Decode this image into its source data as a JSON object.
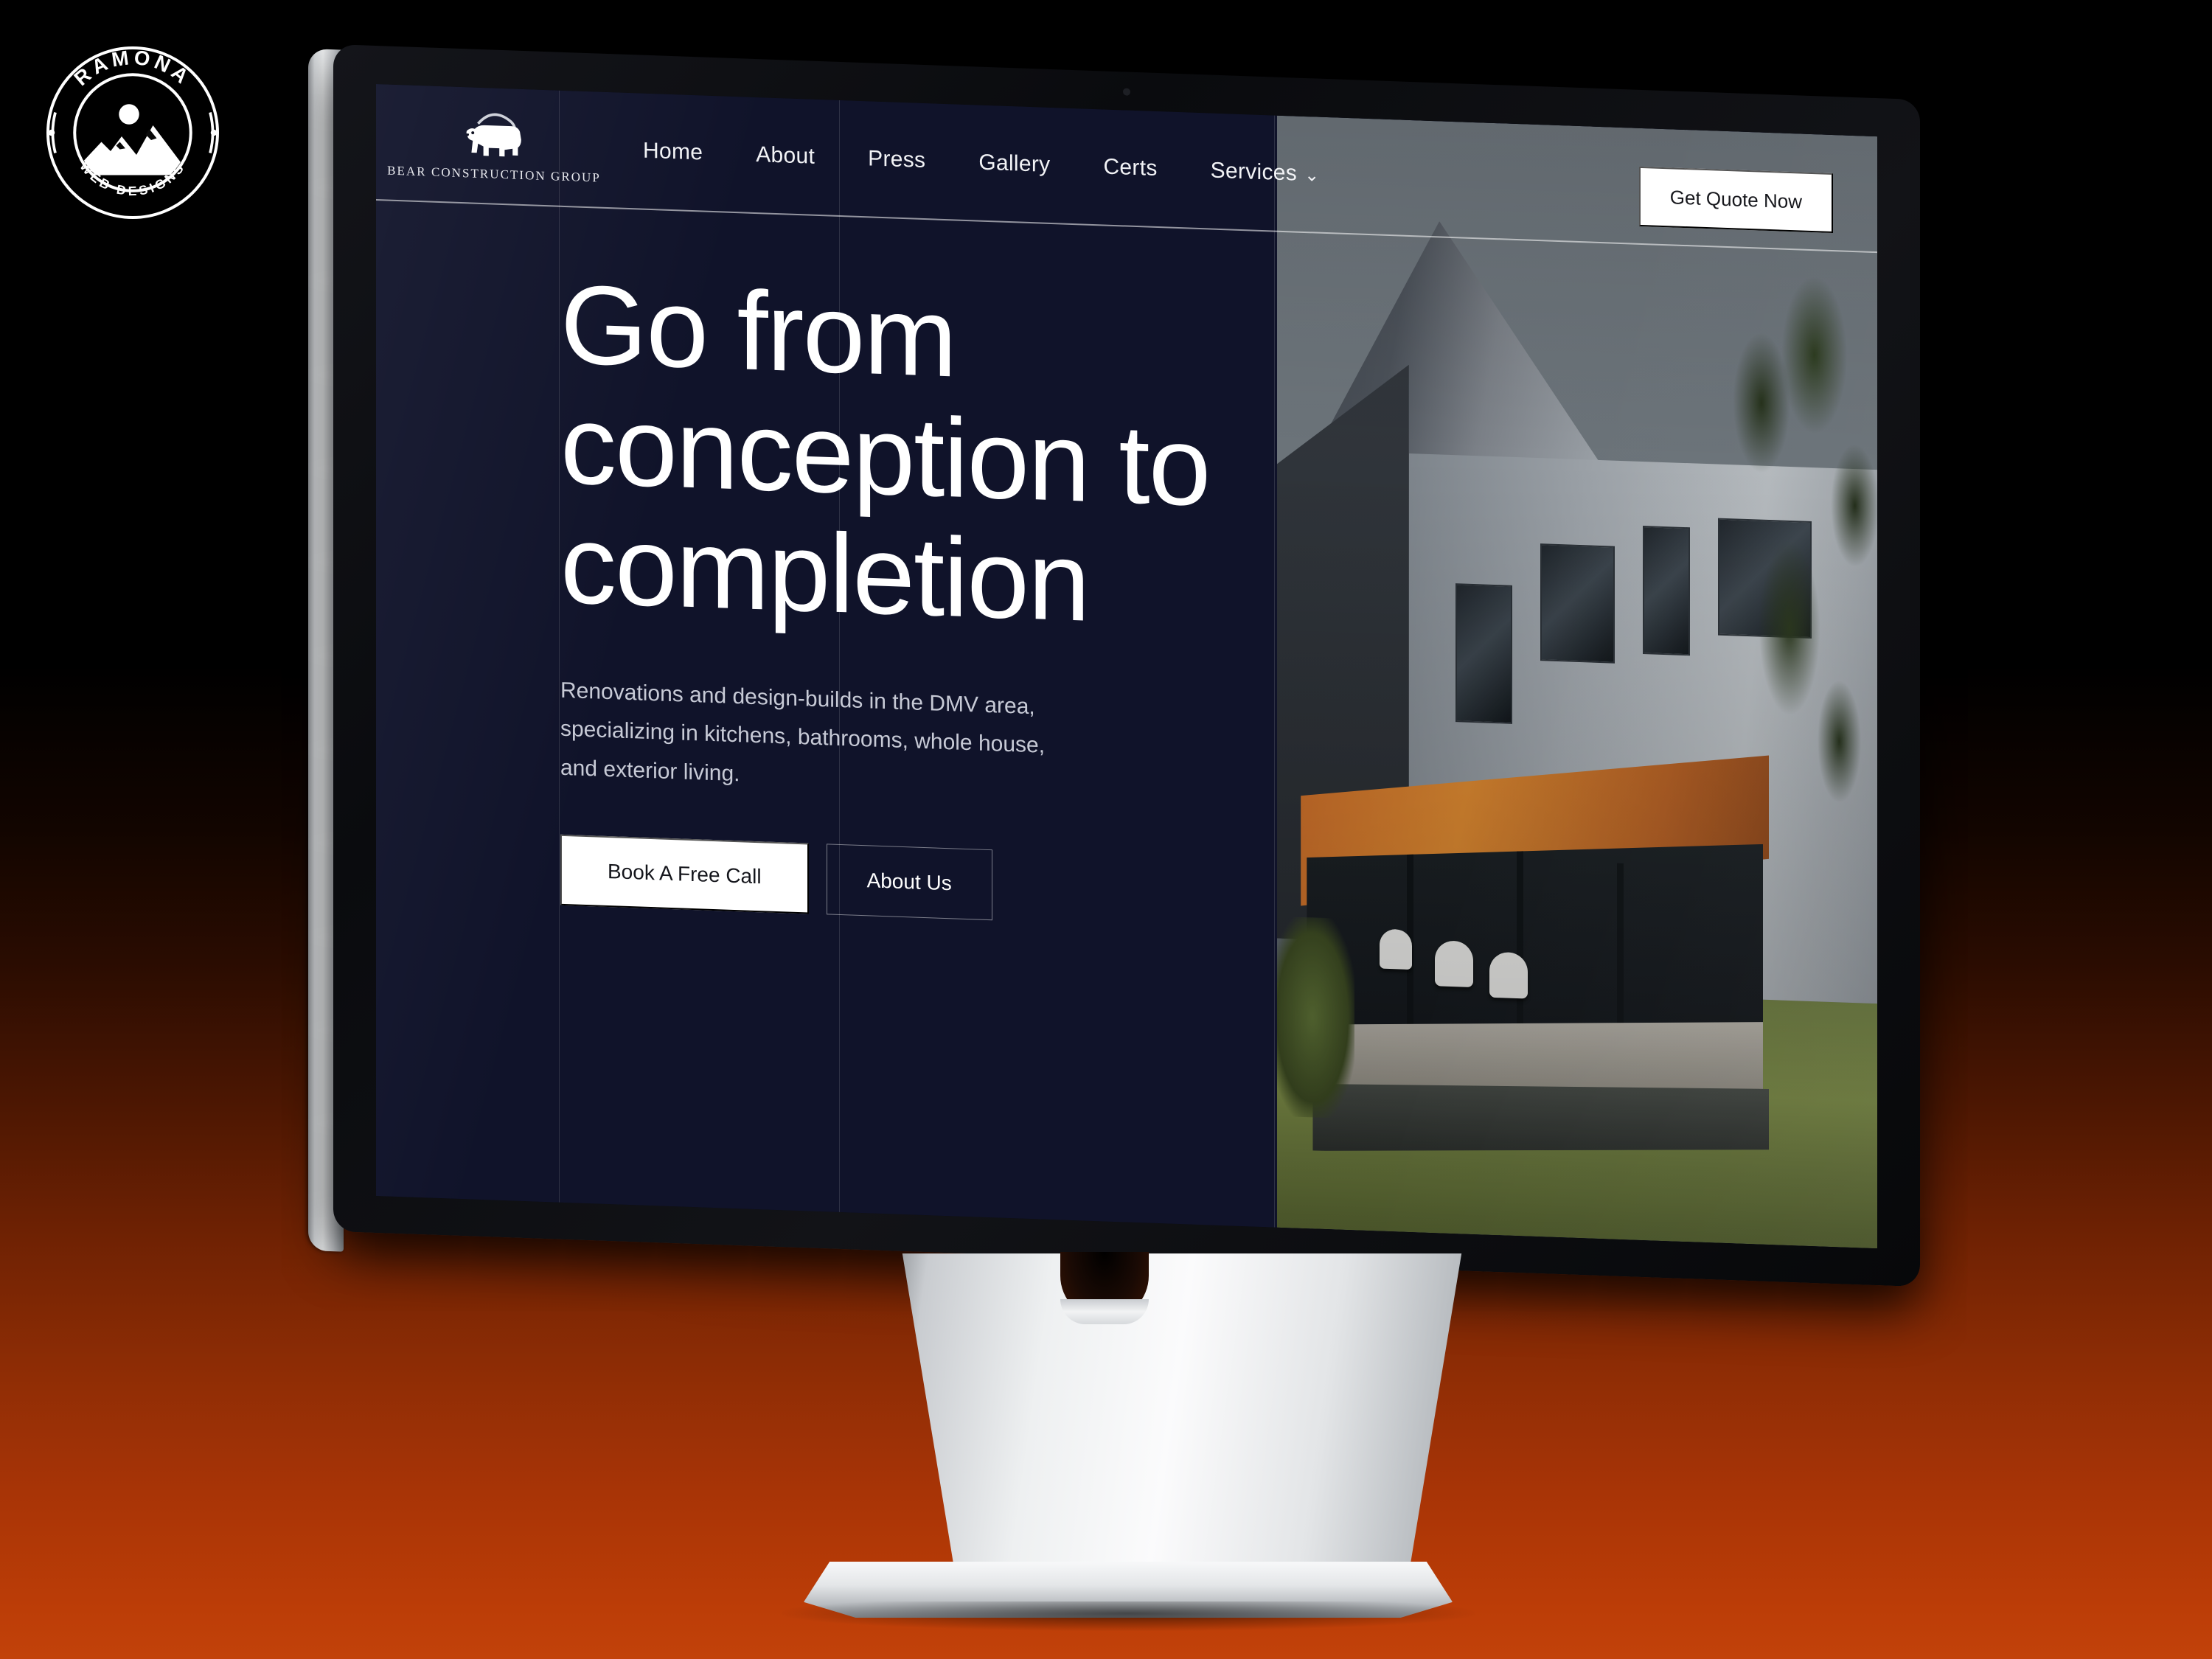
{
  "watermark": {
    "top_arc_text": "RAMONA",
    "bottom_arc_text": "WEB DESIGNS",
    "emblem": "mountain-sun-emblem"
  },
  "device": {
    "type": "desktop-monitor-mockup",
    "frame_color": "#0a0b0e",
    "edge_color": "#eef0f1"
  },
  "background": {
    "gradient_from": "#000000",
    "gradient_to": "#c2420a"
  },
  "site": {
    "theme": {
      "background": "#10132a",
      "text": "#ffffff",
      "muted_text": "#c7cad6",
      "button_bg": "#ffffff",
      "button_text": "#14151b"
    },
    "brand": {
      "logo": "bear-logo",
      "name": "BEAR CONSTRUCTION GROUP"
    },
    "nav": {
      "items": [
        {
          "label": "Home",
          "has_chevron": false
        },
        {
          "label": "About",
          "has_chevron": false
        },
        {
          "label": "Press",
          "has_chevron": false
        },
        {
          "label": "Gallery",
          "has_chevron": false
        },
        {
          "label": "Certs",
          "has_chevron": false
        },
        {
          "label": "Services",
          "has_chevron": true
        }
      ],
      "chevron_glyph": "⌄",
      "cta_label": "Get Quote Now"
    },
    "hero": {
      "headline_line1": "Go from",
      "headline_line2": "conception to",
      "headline_line3": "completion",
      "subtext_line1": "Renovations and design-builds in the DMV area,",
      "subtext_line2": "specializing in kitchens, bathrooms, whole house,",
      "subtext_line3": "and exterior living.",
      "primary_button": "Book A Free Call",
      "secondary_button": "About Us",
      "image_alt": "modern-house-exterior-photo"
    }
  }
}
